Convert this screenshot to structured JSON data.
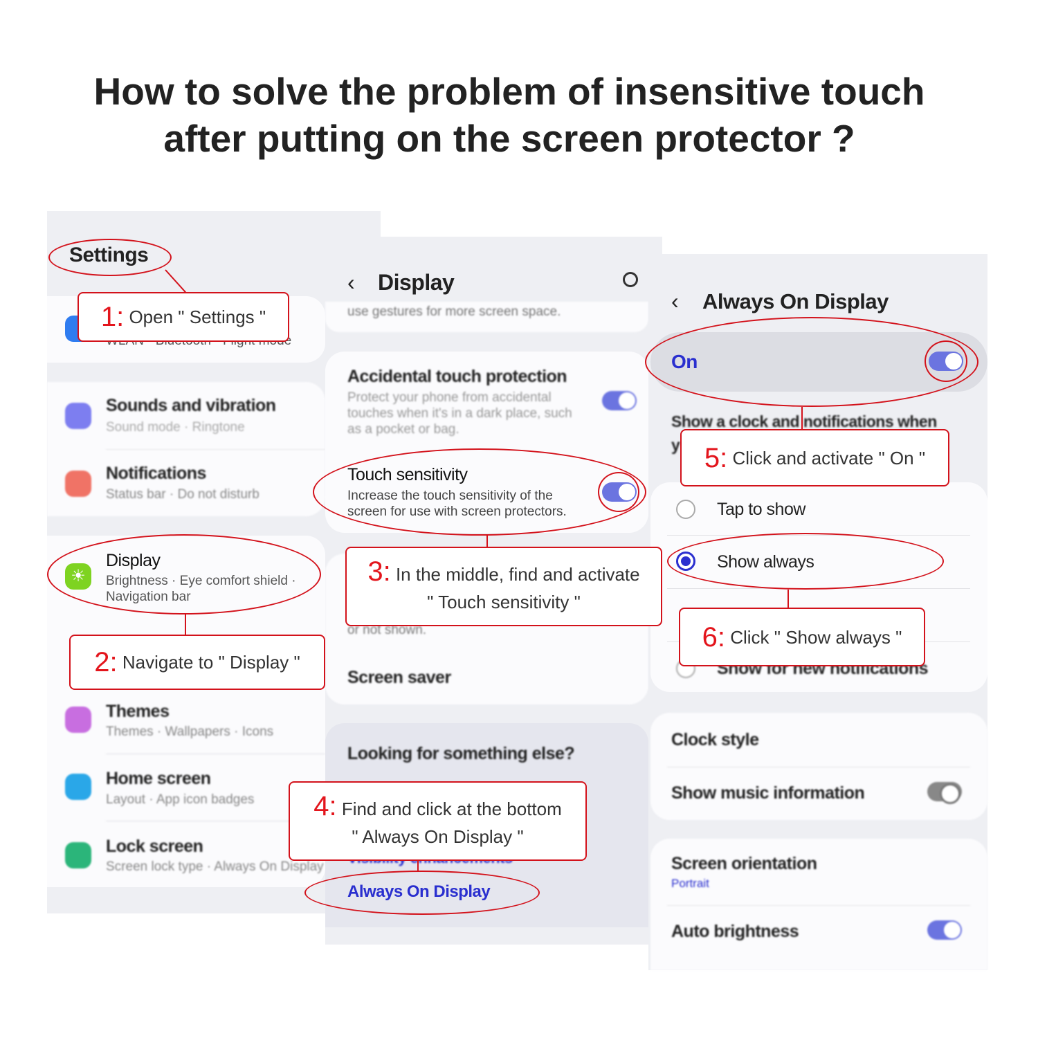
{
  "title": {
    "line1": "How to solve the problem of insensitive touch",
    "line2": "after putting on the screen protector ?"
  },
  "panel1": {
    "header": "Settings",
    "connections_sub": "WLAN  ·  Bluetooth  ·  Flight mode",
    "items": [
      {
        "title": "Sounds and vibration",
        "sub": "Sound mode  ·  Ringtone",
        "icon": "sound-icon",
        "color": "#7d7ef0"
      },
      {
        "title": "Notifications",
        "sub": "Status bar  ·  Do not disturb",
        "icon": "notification-icon",
        "color": "#f07366"
      },
      {
        "title": "Display",
        "sub": "Brightness  ·  Eye comfort shield  ·",
        "sub2": "Navigation bar",
        "icon": "sun-icon",
        "color": "#7ed321"
      },
      {
        "title": "Themes",
        "sub": "Themes  ·  Wallpapers  ·  Icons",
        "icon": "themes-icon",
        "color": "#c86ee0"
      },
      {
        "title": "Home screen",
        "sub": "Layout  ·  App icon badges",
        "icon": "home-icon",
        "color": "#2aa7e8"
      },
      {
        "title": "Lock screen",
        "sub": "Screen lock type  ·  Always On Display",
        "icon": "lock-icon",
        "color": "#2bb57a"
      }
    ]
  },
  "panel2": {
    "header": "Display",
    "top_sub": "use gestures for more screen space.",
    "accidental": {
      "title": "Accidental touch protection",
      "sub": "Protect your phone from accidental touches when it's in a dark place, such as a pocket or bag.",
      "on": true
    },
    "touch": {
      "title": "Touch sensitivity",
      "sub1": "Increase the touch sensitivity of the",
      "sub2": "screen for use with screen protectors.",
      "on": true
    },
    "hidden_sub": "or not shown.",
    "screen_saver": "Screen saver",
    "looking": "Looking for something else?",
    "visibility": "Visibility enhancements",
    "aod_link": "Always On Display",
    "accent": "#2a2fcf"
  },
  "panel3": {
    "header": "Always On Display",
    "on_label": "On",
    "on": true,
    "desc": "Show a clock and notifications when",
    "desc2": "y",
    "options": [
      {
        "label": "Tap to show",
        "selected": false
      },
      {
        "label": "Show always",
        "selected": true
      },
      {
        "label": "Show for new notifications",
        "selected": false
      }
    ],
    "clock_style": "Clock style",
    "music": "Show music information",
    "music_on": false,
    "orientation": "Screen orientation",
    "orientation_value": "Portrait",
    "auto_brightness": "Auto brightness",
    "auto_on": true
  },
  "steps": [
    {
      "n": "1:",
      "text": "Open  \" Settings \""
    },
    {
      "n": "2:",
      "text": "Navigate to  \" Display \""
    },
    {
      "n": "3:",
      "text": "In the middle, find and activate",
      "text2": "\" Touch sensitivity \""
    },
    {
      "n": "4:",
      "text": "Find and click at the bottom",
      "text2": "\" Always On Display \""
    },
    {
      "n": "5:",
      "text": "Click and activate \" On \""
    },
    {
      "n": "6:",
      "text": "Click  \" Show always \""
    }
  ],
  "colors": {
    "annotation": "#d3121b",
    "toggle_on": "#6b74e0"
  }
}
